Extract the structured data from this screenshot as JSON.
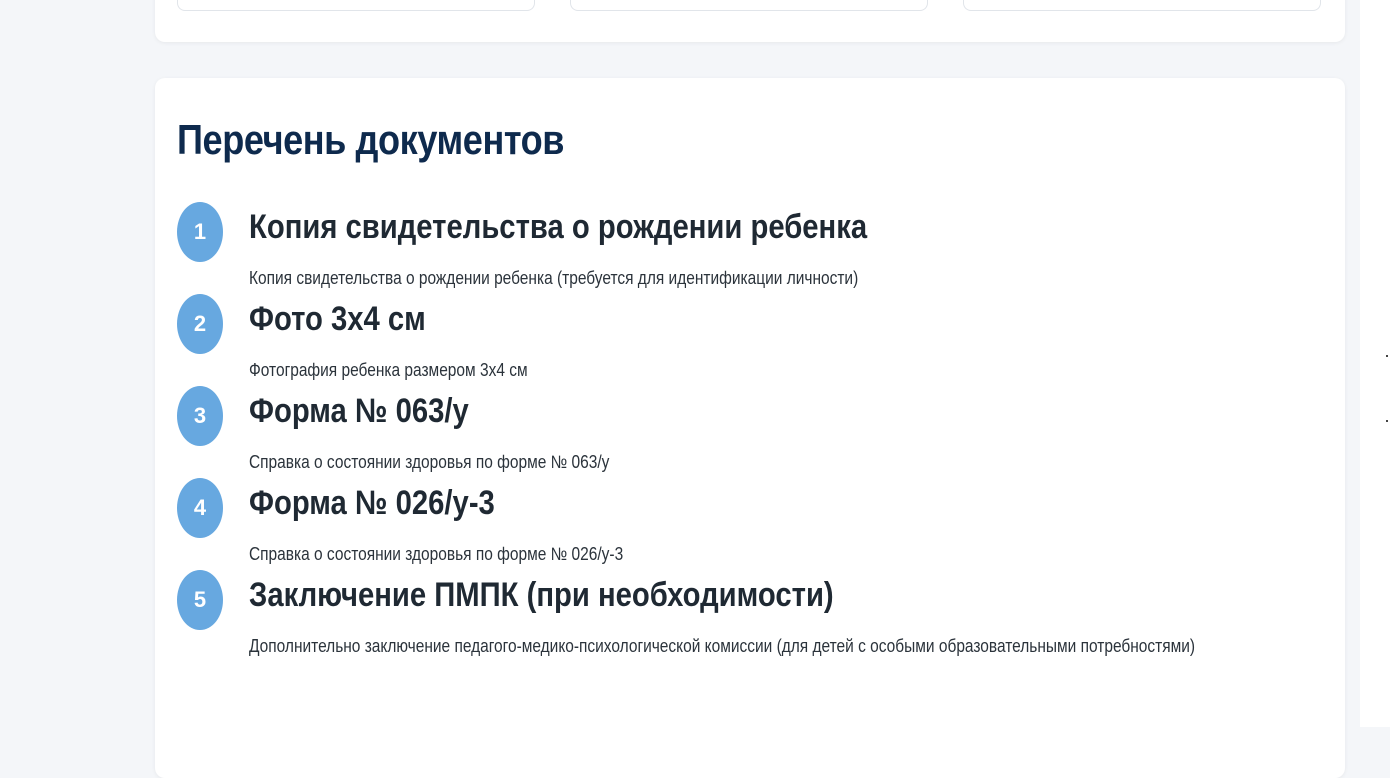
{
  "section": {
    "title": "Перечень документов"
  },
  "documents": [
    {
      "number": "1",
      "title": "Копия свидетельства о рождении ребенка",
      "description": "Копия свидетельства о рождении ребенка (требуется для идентификации личности)"
    },
    {
      "number": "2",
      "title": "Фото 3х4 см",
      "description": "Фотография ребенка размером 3х4 см"
    },
    {
      "number": "3",
      "title": "Форма № 063/у",
      "description": "Справка о состоянии здоровья по форме № 063/у"
    },
    {
      "number": "4",
      "title": "Форма № 026/у-3",
      "description": "Справка о состоянии здоровья по форме № 026/у-3"
    },
    {
      "number": "5",
      "title": "Заключение ПМПК (при необходимости)",
      "description": "Дополнительно заключение педагого-медико-психологической комиссии (для детей с особыми образовательными потребностями)"
    }
  ],
  "colors": {
    "page_background": "#f4f6f9",
    "card_background": "#ffffff",
    "title_color": "#0e2a4d",
    "badge_color": "#67a8e0",
    "text_color": "#1f2933"
  }
}
